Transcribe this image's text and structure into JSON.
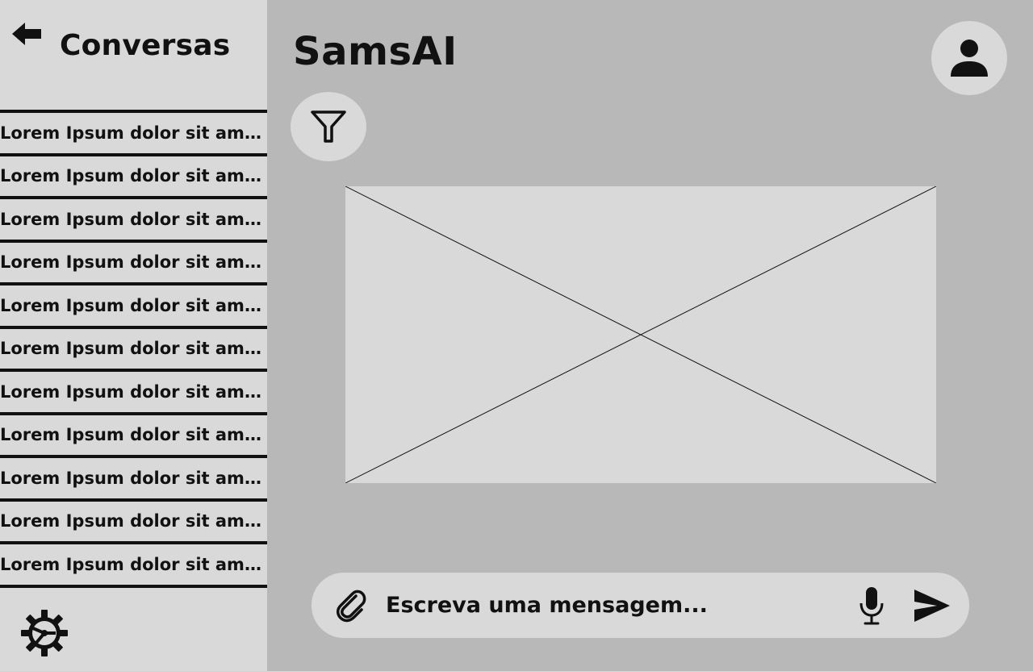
{
  "sidebar": {
    "title": "Conversas",
    "back_icon": "arrow-left-icon",
    "settings_icon": "gear-icon",
    "conversations": [
      {
        "label": "Lorem Ipsum dolor sit ame..."
      },
      {
        "label": "Lorem Ipsum dolor sit ame..."
      },
      {
        "label": "Lorem Ipsum dolor sit ame..."
      },
      {
        "label": "Lorem Ipsum dolor sit ame..."
      },
      {
        "label": "Lorem Ipsum dolor sit ame..."
      },
      {
        "label": "Lorem Ipsum dolor sit ame..."
      },
      {
        "label": "Lorem Ipsum dolor sit ame..."
      },
      {
        "label": "Lorem Ipsum dolor sit ame..."
      },
      {
        "label": "Lorem Ipsum dolor sit ame..."
      },
      {
        "label": "Lorem Ipsum dolor sit ame..."
      },
      {
        "label": "Lorem Ipsum dolor sit ame..."
      }
    ]
  },
  "header": {
    "title": "SamsAI",
    "avatar_icon": "user-icon",
    "filter_icon": "filter-icon"
  },
  "main": {
    "image_placeholder_icon": "image-placeholder"
  },
  "composer": {
    "placeholder": "Escreva uma mensagem...",
    "value": "",
    "attach_icon": "paperclip-icon",
    "mic_icon": "microphone-icon",
    "send_icon": "send-icon"
  },
  "colors": {
    "sidebar_bg": "#d9d9d9",
    "main_bg": "#b8b8b8",
    "control_bg": "#d9d9d9",
    "text": "#111111"
  }
}
